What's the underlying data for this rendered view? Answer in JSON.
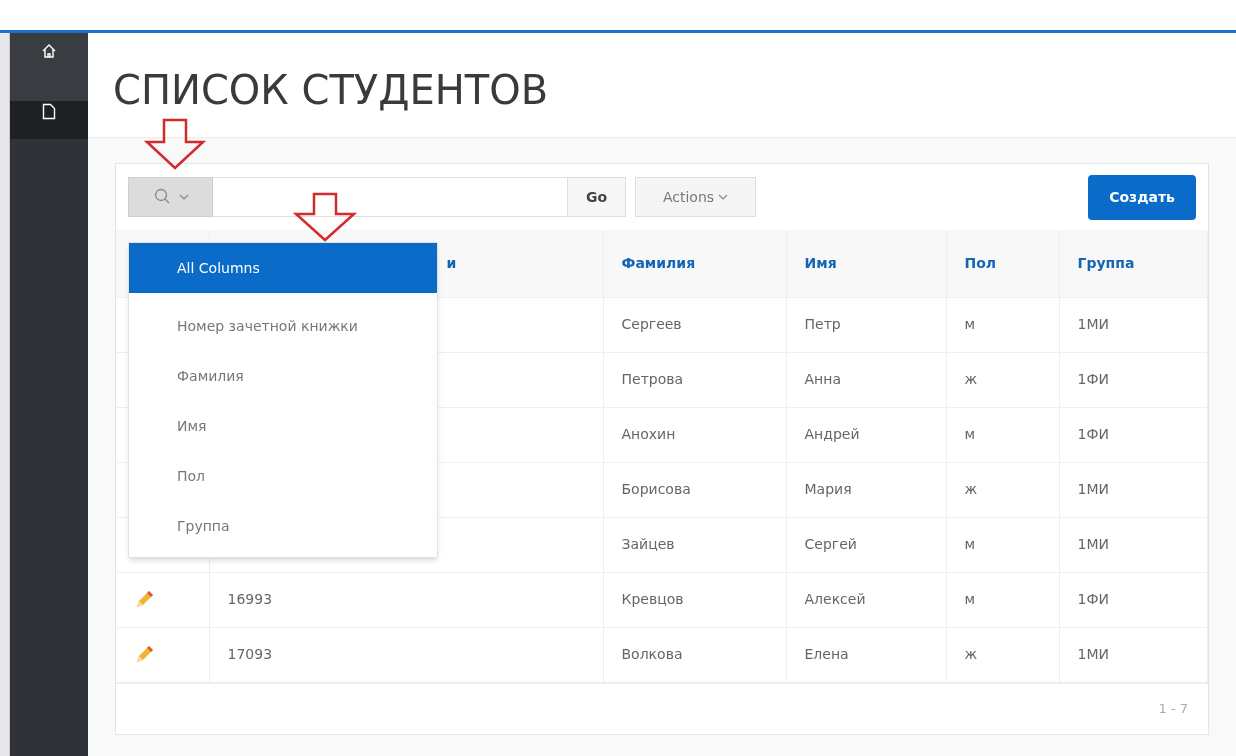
{
  "sidebar": {
    "items": [
      {
        "kind": "home",
        "selected": false
      },
      {
        "kind": "page",
        "selected": true
      }
    ]
  },
  "page_title": "СПИСОК СТУДЕНТОВ",
  "toolbar": {
    "go": "Go",
    "actions": "Actions",
    "create": "Создать"
  },
  "search_menu": {
    "items": [
      {
        "label": "All Columns",
        "selected": true
      },
      {
        "label": "Номер зачетной книжки",
        "selected": false
      },
      {
        "label": "Фамилия",
        "selected": false
      },
      {
        "label": "Имя",
        "selected": false
      },
      {
        "label": "Пол",
        "selected": false
      },
      {
        "label": "Группа",
        "selected": false
      }
    ]
  },
  "table": {
    "columns": [
      "и",
      "Фамилия",
      "Имя",
      "Пол",
      "Группа"
    ],
    "rows": [
      {
        "edit_icon": false,
        "last": "Сергеев",
        "first": "Петр",
        "sex": "м",
        "group": "1МИ"
      },
      {
        "edit_icon": false,
        "last": "Петрова",
        "first": "Анна",
        "sex": "ж",
        "group": "1ФИ"
      },
      {
        "edit_icon": false,
        "last": "Анохин",
        "first": "Андрей",
        "sex": "м",
        "group": "1ФИ"
      },
      {
        "edit_icon": false,
        "last": "Борисова",
        "first": "Мария",
        "sex": "ж",
        "group": "1МИ"
      },
      {
        "edit_icon": false,
        "last": "Зайцев",
        "first": "Сергей",
        "sex": "м",
        "group": "1МИ"
      },
      {
        "edit_icon": true,
        "number": "16993",
        "last": "Кревцов",
        "first": "Алексей",
        "sex": "м",
        "group": "1ФИ"
      },
      {
        "edit_icon": true,
        "number": "17093",
        "last": "Волкова",
        "first": "Елена",
        "sex": "ж",
        "group": "1МИ"
      }
    ]
  },
  "pagination": "1 - 7"
}
